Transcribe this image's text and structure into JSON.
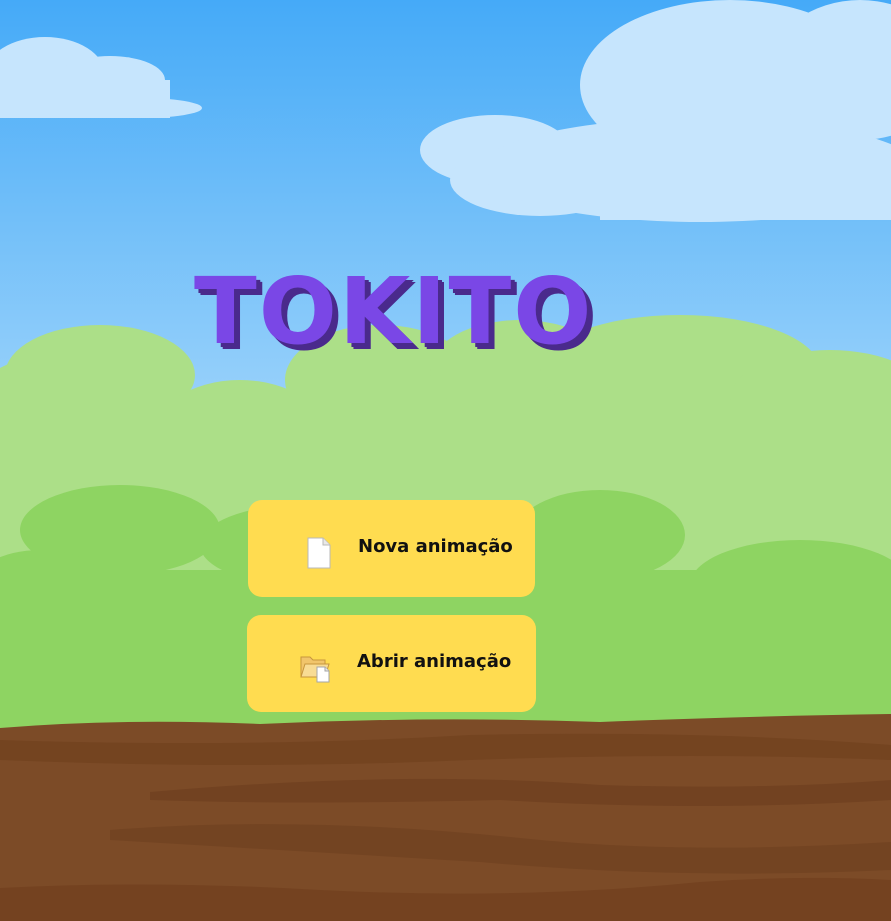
{
  "app": {
    "title": "TOKITO"
  },
  "menu": {
    "new_animation": {
      "label": "Nova animação",
      "icon": "new-document-icon"
    },
    "open_animation": {
      "label": "Abrir animação",
      "icon": "open-folder-icon"
    }
  },
  "colors": {
    "sky_top": "#45aaf8",
    "sky_bottom": "#bfe2fb",
    "cloud": "#c6e5fd",
    "bush_light": "#acdf88",
    "bush_dark": "#8ed462",
    "ground": "#7c4b27",
    "ground_dark": "#6e3f1f",
    "title": "#7a47e6",
    "title_shadow": "#4a2a8c",
    "button": "#ffdc50"
  }
}
